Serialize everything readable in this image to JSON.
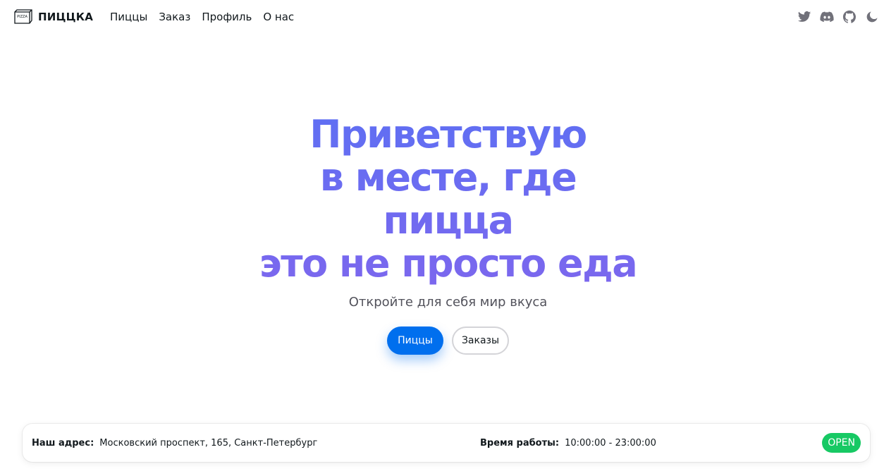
{
  "brand": {
    "logo_text": "PIZZA",
    "name": "ПИЦЦКА"
  },
  "nav": {
    "links": [
      {
        "label": "Пиццы"
      },
      {
        "label": "Заказ"
      },
      {
        "label": "Профиль"
      },
      {
        "label": "О нас"
      }
    ],
    "icons": [
      "twitter-icon",
      "discord-icon",
      "github-icon",
      "moon-icon"
    ]
  },
  "hero": {
    "title_lines": [
      "Приветствую",
      "в месте, где",
      "пицца",
      "это не просто еда"
    ],
    "subtitle": "Откройте для себя мир вкуса",
    "primary_button": "Пиццы",
    "secondary_button": "Заказы"
  },
  "info": {
    "address_label": "Наш адрес:",
    "address_value": "Московский проспект, 165, Санкт-Петербург",
    "hours_label": "Время работы:",
    "hours_value": "10:00:00 - 23:00:00",
    "status": "OPEN"
  },
  "colors": {
    "primary": "#006fee",
    "title_gradient_start": "#5f6ff3",
    "title_gradient_end": "#7b67ee",
    "status_open": "#17c964",
    "icon_gray": "#71717a"
  }
}
